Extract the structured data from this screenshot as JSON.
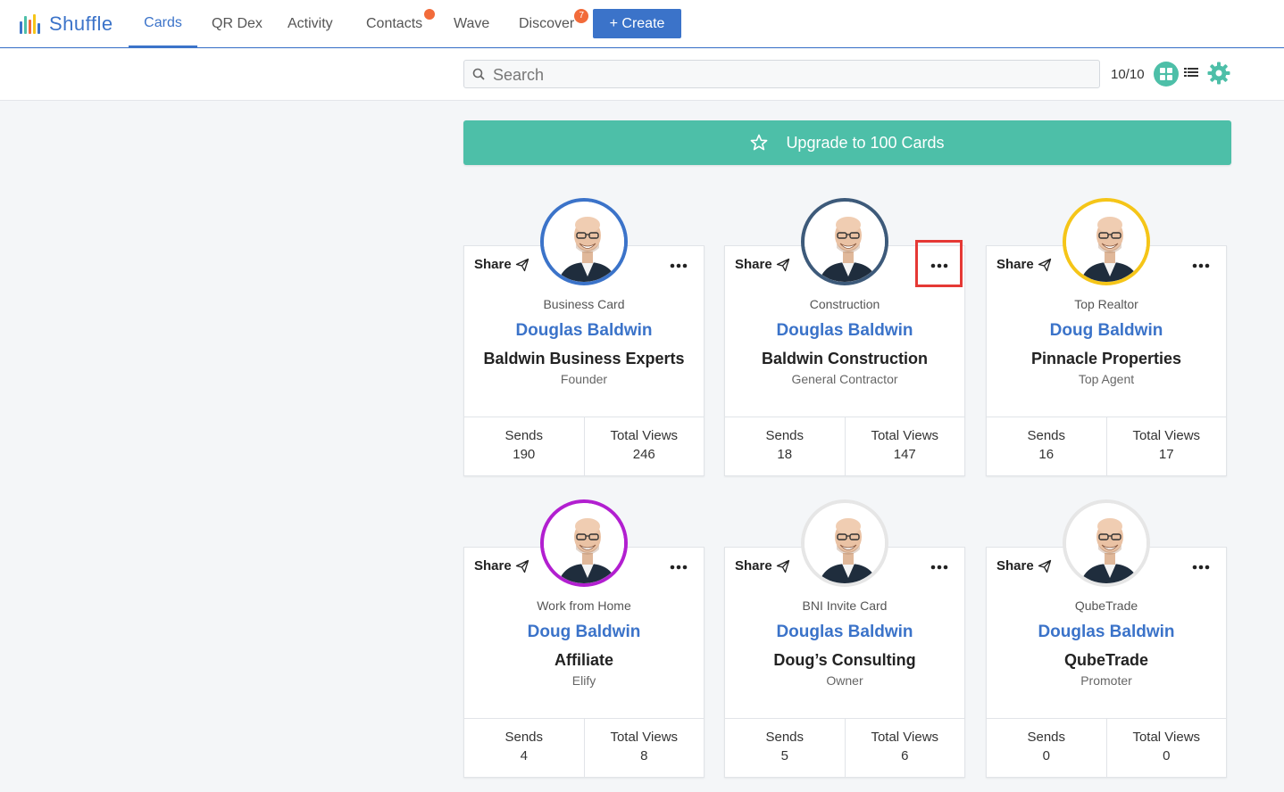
{
  "app": {
    "name": "Shuffle",
    "brand_color": "#3b73c9",
    "accent_color": "#4dbfa8"
  },
  "nav": {
    "tabs": [
      {
        "label": "Cards",
        "active": true
      },
      {
        "label": "QR Dex"
      },
      {
        "label": "Activity"
      },
      {
        "label": "Contacts",
        "dot": true
      },
      {
        "label": "Wave"
      },
      {
        "label": "Discover",
        "badge": "7"
      }
    ],
    "create_label": "+ Create"
  },
  "toolbar": {
    "search_placeholder": "Search",
    "count": "10/10",
    "icons": [
      "grid-view-icon",
      "list-view-icon",
      "gear-icon"
    ]
  },
  "upgrade": {
    "label": "Upgrade to 100 Cards",
    "icon": "star-icon"
  },
  "cards": [
    {
      "share": "Share",
      "type": "Business Card",
      "name": "Douglas Baldwin",
      "company": "Baldwin Business Experts",
      "title": "Founder",
      "sends_label": "Sends",
      "sends": "190",
      "views_label": "Total Views",
      "views": "246",
      "ring": "#3b73c9"
    },
    {
      "share": "Share",
      "type": "Construction",
      "name": "Douglas Baldwin",
      "company": "Baldwin Construction",
      "title": "General Contractor",
      "sends_label": "Sends",
      "sends": "18",
      "views_label": "Total Views",
      "views": "147",
      "ring": "#3d5a7a"
    },
    {
      "share": "Share",
      "type": "Top Realtor",
      "name": "Doug Baldwin",
      "company": "Pinnacle Properties",
      "title": "Top Agent",
      "sends_label": "Sends",
      "sends": "16",
      "views_label": "Total Views",
      "views": "17",
      "ring": "#f5c518"
    },
    {
      "share": "Share",
      "type": "Work from Home",
      "name": "Doug Baldwin",
      "company": "Affiliate",
      "title": "Elify",
      "sends_label": "Sends",
      "sends": "4",
      "views_label": "Total Views",
      "views": "8",
      "ring": "#b21fd0"
    },
    {
      "share": "Share",
      "type": "BNI Invite Card",
      "name": "Douglas Baldwin",
      "company": "Doug’s Consulting",
      "title": "Owner",
      "sends_label": "Sends",
      "sends": "5",
      "views_label": "Total Views",
      "views": "6",
      "ring": "#e6e6e6"
    },
    {
      "share": "Share",
      "type": "QubeTrade",
      "name": "Douglas Baldwin",
      "company": "QubeTrade",
      "title": "Promoter",
      "sends_label": "Sends",
      "sends": "0",
      "views_label": "Total Views",
      "views": "0",
      "ring": "#e6e6e6"
    }
  ]
}
